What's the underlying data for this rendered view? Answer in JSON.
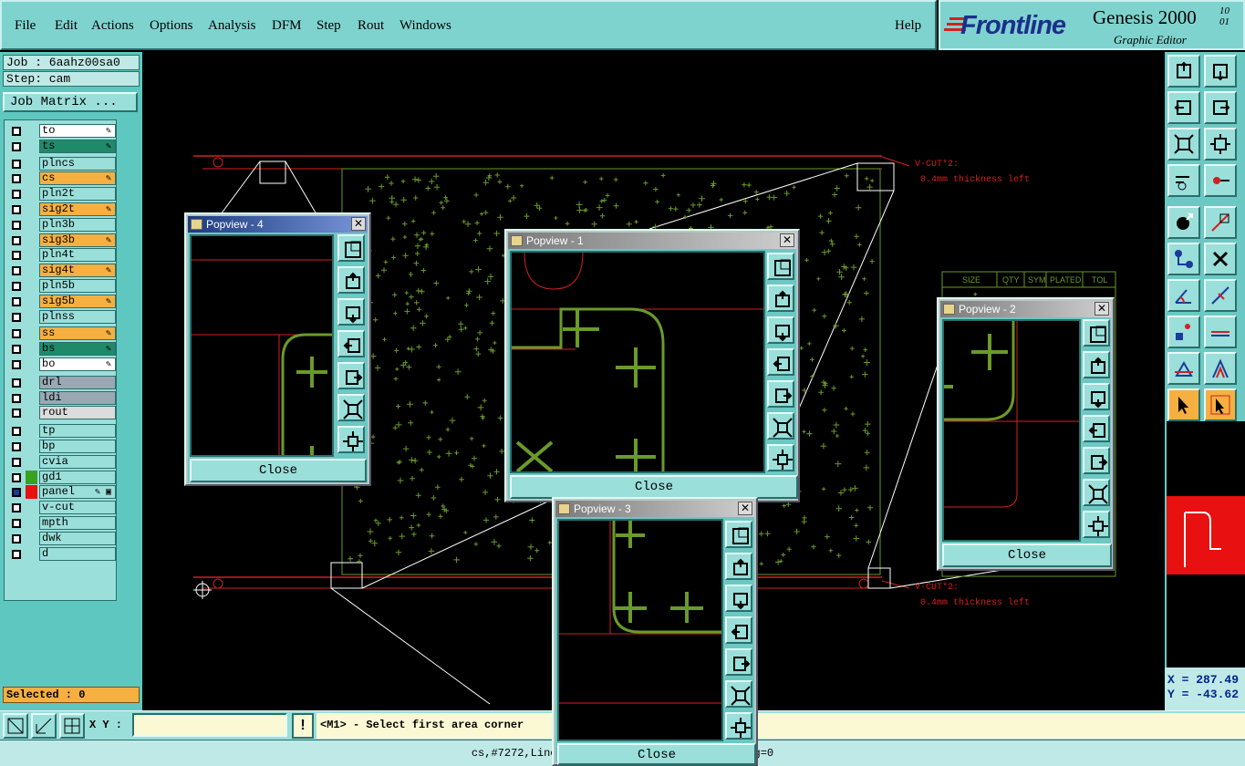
{
  "menu": {
    "file": "File",
    "edit": "Edit",
    "actions": "Actions",
    "options": "Options",
    "analysis": "Analysis",
    "dfm": "DFM",
    "step": "Step",
    "rout": "Rout",
    "windows": "Windows",
    "help": "Help"
  },
  "brand": {
    "logo": "Frontline",
    "product": "Genesis 2000",
    "version_top": "10",
    "version_bottom": "01",
    "subtitle": "Graphic Editor"
  },
  "job": {
    "job_line": "Job : 6aahz00sa0",
    "step_line": "Step: cam",
    "matrix_button": "Job Matrix ..."
  },
  "layers": [
    {
      "name": "to",
      "color": "#ffffff",
      "flag": "✎"
    },
    {
      "name": "ts",
      "color": "#1f8a6a",
      "flag": "✎"
    },
    {
      "name": "plncs",
      "color": "#9adfda",
      "flag": ""
    },
    {
      "name": "cs",
      "color": "#f5b041",
      "flag": "✎"
    },
    {
      "name": "pln2t",
      "color": "#9adfda",
      "flag": ""
    },
    {
      "name": "sig2t",
      "color": "#f5b041",
      "flag": "✎"
    },
    {
      "name": "pln3b",
      "color": "#9adfda",
      "flag": ""
    },
    {
      "name": "sig3b",
      "color": "#f5b041",
      "flag": "✎"
    },
    {
      "name": "pln4t",
      "color": "#9adfda",
      "flag": ""
    },
    {
      "name": "sig4t",
      "color": "#f5b041",
      "flag": "✎"
    },
    {
      "name": "pln5b",
      "color": "#9adfda",
      "flag": ""
    },
    {
      "name": "sig5b",
      "color": "#f5b041",
      "flag": "✎"
    },
    {
      "name": "plnss",
      "color": "#9adfda",
      "flag": ""
    },
    {
      "name": "ss",
      "color": "#f5b041",
      "flag": "✎"
    },
    {
      "name": "bs",
      "color": "#1f8a6a",
      "flag": "✎"
    },
    {
      "name": "bo",
      "color": "#ffffff",
      "flag": "✎"
    },
    {
      "name": "drl",
      "color": "#9aa8b4",
      "flag": ""
    },
    {
      "name": "ldi",
      "color": "#9aa8b4",
      "flag": ""
    },
    {
      "name": "rout",
      "color": "#dcdcdc",
      "flag": ""
    },
    {
      "name": "tp",
      "color": "#9adfda",
      "flag": ""
    },
    {
      "name": "bp",
      "color": "#9adfda",
      "flag": ""
    },
    {
      "name": "cvia",
      "color": "#9adfda",
      "flag": ""
    },
    {
      "name": "gd1",
      "color": "#9adfda",
      "flag": ""
    },
    {
      "name": "panel",
      "color": "#9adfda",
      "flag": "✎ ▣"
    },
    {
      "name": "v-cut",
      "color": "#9adfda",
      "flag": ""
    },
    {
      "name": "mpth",
      "color": "#9adfda",
      "flag": ""
    },
    {
      "name": "dwk",
      "color": "#9adfda",
      "flag": ""
    },
    {
      "name": "d",
      "color": "#9adfda",
      "flag": ""
    }
  ],
  "selected_label": "Selected : 0",
  "canvas": {
    "vcut_top_1": "V-CUT*2:",
    "vcut_top_2": "0.4mm thickness left",
    "vcut_bot_1": "V-CUT*2:",
    "vcut_bot_2": "0.4mm thickness left",
    "table_headers": [
      "SIZE",
      "QTY",
      "SYM",
      "PLATED",
      "TOL"
    ]
  },
  "popviews": {
    "p1": {
      "title": "Popview - 1",
      "close": "Close"
    },
    "p2": {
      "title": "Popview - 2",
      "close": "Close"
    },
    "p3": {
      "title": "Popview - 3",
      "close": "Close"
    },
    "p4": {
      "title": "Popview - 4",
      "close": "Close"
    }
  },
  "coords": {
    "x": "X = 287.49",
    "y": "Y = -43.62"
  },
  "bottom": {
    "xy_label": "X Y :",
    "xy_value": "",
    "bang": "!",
    "prompt": "<M1> - Select first area corner"
  },
  "status_line": "cs,#7272,Line,XS=5.65...42686,r6.401,POS,Ang=0",
  "colors": {
    "accent_teal": "#7fd3cf",
    "highlight_orange": "#f5b041",
    "trace_green": "#6a9a2a",
    "outline_red": "#d42020"
  }
}
